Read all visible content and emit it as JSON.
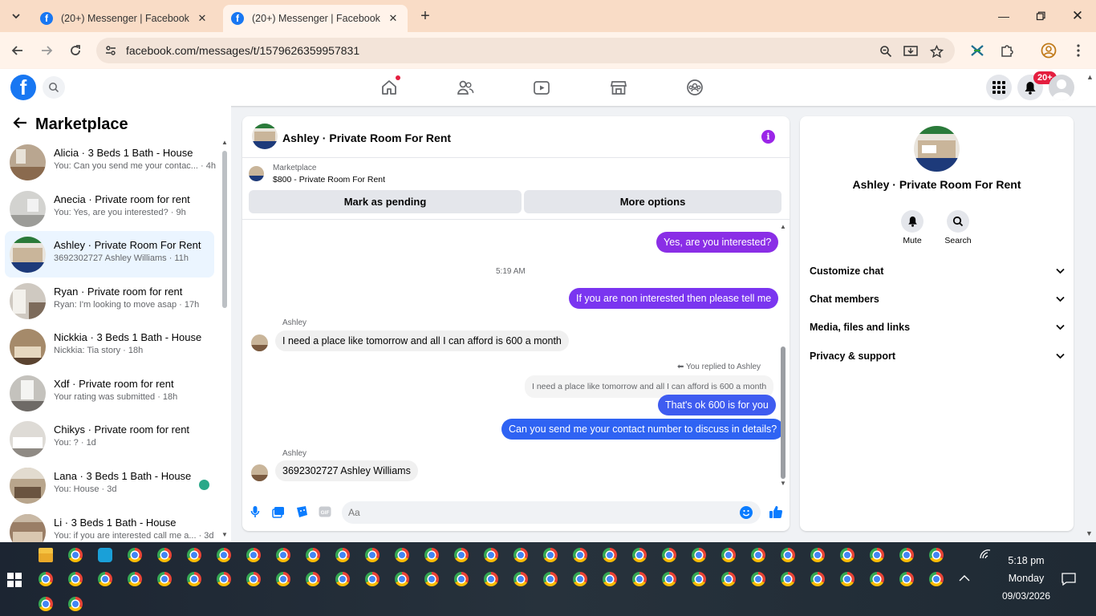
{
  "browser": {
    "tabs": [
      {
        "title": "(20+) Messenger | Facebook",
        "active": false
      },
      {
        "title": "(20+) Messenger | Facebook",
        "active": true
      }
    ],
    "url": "facebook.com/messages/t/1579626359957831",
    "icons": [
      "tab-search-icon",
      "new-tab-icon",
      "minimize-icon",
      "maximize-icon",
      "close-icon",
      "back-icon",
      "forward-icon",
      "reload-icon",
      "site-info-icon",
      "zoom-icon",
      "install-icon",
      "bookmark-star-icon",
      "extension-icon",
      "puzzle-icon",
      "profile-icon",
      "menu-icon"
    ]
  },
  "fb": {
    "notifications_badge": "20+",
    "nav": [
      "home-icon",
      "friends-icon",
      "watch-icon",
      "marketplace-icon",
      "groups-icon"
    ]
  },
  "left": {
    "title": "Marketplace",
    "chats": [
      {
        "name": "Alicia · 3 Beds 1 Bath - House",
        "snippet": "You: Can you send me your contac... · 4h"
      },
      {
        "name": "Anecia · Private room for rent",
        "snippet": "You: Yes, are you interested? · 9h"
      },
      {
        "name": "Ashley · Private Room For Rent",
        "snippet": "3692302727 Ashley Williams · 11h"
      },
      {
        "name": "Ryan · Private room for rent",
        "snippet": "Ryan: I'm looking to move asap · 17h"
      },
      {
        "name": "Nickkia · 3 Beds 1 Bath - House",
        "snippet": "Nickkia: Tia story · 18h"
      },
      {
        "name": "Xdf · Private room for rent",
        "snippet": "Your rating was submitted · 18h"
      },
      {
        "name": "Chikys · Private room for rent",
        "snippet": "You: ? · 1d"
      },
      {
        "name": "Lana · 3 Beds 1 Bath - House",
        "snippet": "You: House · 3d"
      },
      {
        "name": "Li · 3 Beds 1 Bath - House",
        "snippet": "You: if you are interested call me a... · 3d"
      }
    ]
  },
  "convo": {
    "title": "Ashley · Private Room For Rent",
    "listing_label": "Marketplace",
    "listing_title": "$800 - Private Room For Rent",
    "mark_pending": "Mark as pending",
    "more_options": "More options",
    "messages": {
      "m1": "Yes, are you interested?",
      "time": "5:19 AM",
      "m2": "If you are non interested then please tell me",
      "sender1": "Ashley",
      "m3": "I need a place like tomorrow and all I can afford is 600 a month",
      "replied": "You replied to Ashley",
      "quote": "I need a place like tomorrow and all I can afford is 600 a month",
      "m4": "That's ok 600 is for you",
      "m5": "Can you send me your contact number to discuss in details?",
      "sender2": "Ashley",
      "m6": "3692302727 Ashley Williams"
    },
    "composer_placeholder": "Aa"
  },
  "right": {
    "name": "Ashley · Private Room For Rent",
    "mute": "Mute",
    "search": "Search",
    "sections": [
      "Customize chat",
      "Chat members",
      "Media, files and links",
      "Privacy & support"
    ]
  },
  "taskbar": {
    "time": "5:18 pm",
    "day": "Monday",
    "date": "09/03/2026"
  },
  "colors": {
    "accent_purple": "#9b25e8",
    "bubble_gradient": [
      "#a033ff",
      "#0a7cff"
    ],
    "fb_blue": "#1877f2"
  }
}
